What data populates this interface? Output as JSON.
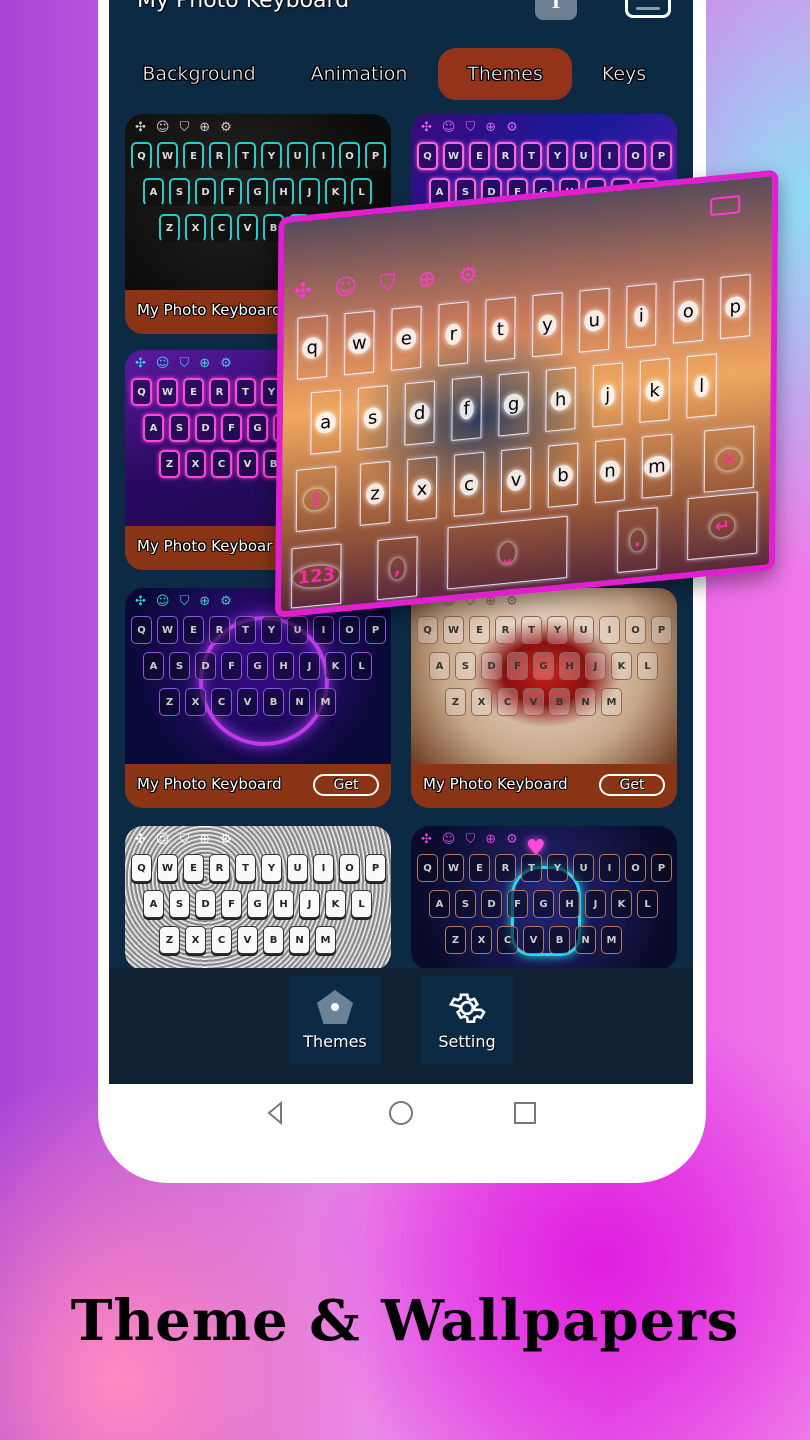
{
  "app": {
    "title": "My Photo Keyboard",
    "icons": [
      "font-icon",
      "keyboard-icon"
    ]
  },
  "tabs": [
    {
      "label": "Background",
      "active": false
    },
    {
      "label": "Animation",
      "active": false
    },
    {
      "label": "Themes",
      "active": true
    },
    {
      "label": "Keys",
      "active": false
    }
  ],
  "theme_cards": [
    {
      "name": "My Photo Keyboard",
      "style": "black-cyan-neon",
      "get": null
    },
    {
      "name": "",
      "style": "purple-laser-neon",
      "get": null
    },
    {
      "name": "My Photo Keyboar",
      "style": "pink-fireworks-neon",
      "get": null
    },
    {
      "name": "",
      "style": "monster-truck",
      "get": null
    },
    {
      "name": "My Photo Keyboard",
      "style": "neon-ring-leaves",
      "get": "Get"
    },
    {
      "name": "My Photo Keyboard",
      "style": "red-bow",
      "get": "Get"
    },
    {
      "name": "",
      "style": "silver-glitter",
      "get": null
    },
    {
      "name": "",
      "style": "neon-heart-hand",
      "get": null
    }
  ],
  "keyboard": {
    "toolbar_icons": [
      "apps-icon",
      "emoji-icon",
      "shirt-icon",
      "globe-icon",
      "gear-icon"
    ],
    "row1": [
      "Q",
      "W",
      "E",
      "R",
      "T",
      "Y",
      "U",
      "I",
      "O",
      "P"
    ],
    "row2": [
      "A",
      "S",
      "D",
      "F",
      "G",
      "H",
      "J",
      "K",
      "L"
    ],
    "row3": [
      "Z",
      "X",
      "C",
      "V",
      "B",
      "N",
      "M"
    ],
    "numbers_key": "123"
  },
  "featured_keyboard": {
    "row1": [
      "q",
      "w",
      "e",
      "r",
      "t",
      "y",
      "u",
      "i",
      "o",
      "p"
    ],
    "row2": [
      "a",
      "s",
      "d",
      "f",
      "g",
      "h",
      "j",
      "k",
      "l"
    ],
    "row3": [
      "z",
      "x",
      "c",
      "v",
      "b",
      "n",
      "m"
    ],
    "numbers_key": "123",
    "comma_key": ",",
    "period_key": ".",
    "accent_color": "#e020d0"
  },
  "bottom_nav": [
    {
      "label": "Themes",
      "icon": "pentagon-icon"
    },
    {
      "label": "Setting",
      "icon": "gear-icon"
    }
  ],
  "system_nav": [
    "back-icon",
    "home-icon",
    "recents-icon"
  ],
  "caption": "Theme & Wallpapers",
  "colors": {
    "screen_bg": "#0c2a44",
    "tab_active": "#93341a",
    "card_footer": "#8a3416",
    "bottom_nav_bg": "#0f2133",
    "neon_pink": "#e020d0"
  }
}
